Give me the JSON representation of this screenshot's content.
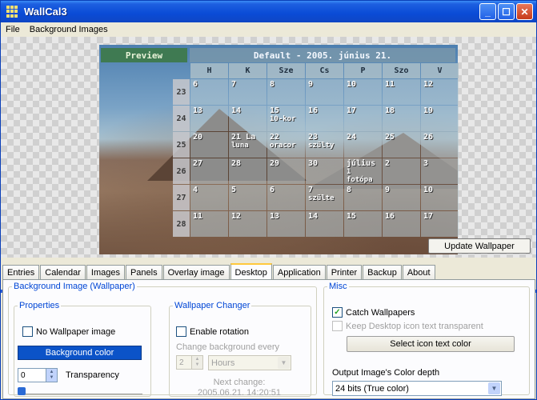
{
  "window": {
    "title": "WallCal3"
  },
  "menu": [
    "File",
    "Background Images"
  ],
  "preview": {
    "label": "Preview",
    "calendar_title": "Default - 2005. június 21.",
    "day_headers": [
      "H",
      "K",
      "Sze",
      "Cs",
      "P",
      "Szo",
      "V"
    ],
    "weeks": [
      {
        "week": "23",
        "days": [
          {
            "n": "6",
            "ev": ""
          },
          {
            "n": "7",
            "ev": ""
          },
          {
            "n": "8",
            "ev": ""
          },
          {
            "n": "9",
            "ev": ""
          },
          {
            "n": "10",
            "ev": ""
          },
          {
            "n": "11",
            "ev": ""
          },
          {
            "n": "12",
            "ev": ""
          }
        ]
      },
      {
        "week": "24",
        "days": [
          {
            "n": "13",
            "ev": ""
          },
          {
            "n": "14",
            "ev": ""
          },
          {
            "n": "15",
            "ev": "10-kor"
          },
          {
            "n": "16",
            "ev": ""
          },
          {
            "n": "17",
            "ev": ""
          },
          {
            "n": "18",
            "ev": ""
          },
          {
            "n": "19",
            "ev": ""
          }
        ]
      },
      {
        "week": "25",
        "days": [
          {
            "n": "20",
            "ev": ""
          },
          {
            "n": "21 La",
            "ev": "luna"
          },
          {
            "n": "22",
            "ev": "oracor"
          },
          {
            "n": "23",
            "ev": "szülty"
          },
          {
            "n": "24",
            "ev": ""
          },
          {
            "n": "25",
            "ev": ""
          },
          {
            "n": "26",
            "ev": ""
          }
        ]
      },
      {
        "week": "26",
        "days": [
          {
            "n": "27",
            "ev": ""
          },
          {
            "n": "28",
            "ev": ""
          },
          {
            "n": "29",
            "ev": ""
          },
          {
            "n": "30",
            "ev": ""
          },
          {
            "n": "július",
            "ev": "1 fotópa"
          },
          {
            "n": "2",
            "ev": ""
          },
          {
            "n": "3",
            "ev": ""
          }
        ]
      },
      {
        "week": "27",
        "days": [
          {
            "n": "4",
            "ev": ""
          },
          {
            "n": "5",
            "ev": ""
          },
          {
            "n": "6",
            "ev": ""
          },
          {
            "n": "7",
            "ev": "szülte"
          },
          {
            "n": "8",
            "ev": ""
          },
          {
            "n": "9",
            "ev": ""
          },
          {
            "n": "10",
            "ev": ""
          }
        ]
      },
      {
        "week": "28",
        "days": [
          {
            "n": "11",
            "ev": ""
          },
          {
            "n": "12",
            "ev": ""
          },
          {
            "n": "13",
            "ev": ""
          },
          {
            "n": "14",
            "ev": ""
          },
          {
            "n": "15",
            "ev": ""
          },
          {
            "n": "16",
            "ev": ""
          },
          {
            "n": "17",
            "ev": ""
          }
        ]
      }
    ],
    "update_button": "Update Wallpaper"
  },
  "tabs": [
    "Entries",
    "Calendar",
    "Images",
    "Panels",
    "Overlay image",
    "Desktop",
    "Application",
    "Printer",
    "Backup",
    "About"
  ],
  "active_tab": "Desktop",
  "desktop": {
    "background_group": "Background Image (Wallpaper)",
    "properties_group": "Properties",
    "no_wallpaper_label": "No Wallpaper image",
    "no_wallpaper_checked": false,
    "background_color_button": "Background color",
    "transparency_value": "0",
    "transparency_label": "Transparency",
    "transparency_level": 0,
    "changer_group": "Wallpaper Changer",
    "enable_rotation_label": "Enable rotation",
    "enable_rotation_checked": false,
    "change_every_label": "Change background every",
    "interval_value": "2",
    "interval_unit": "Hours",
    "next_change_label": "Next change:",
    "next_change_value": "2005.06.21. 14:20:51",
    "misc_group": "Misc",
    "catch_wallpapers_label": "Catch Wallpapers",
    "catch_wallpapers_checked": true,
    "keep_transparent_label": "Keep Desktop icon text transparent",
    "select_icon_color_button": "Select icon text color",
    "color_depth_label": "Output Image's Color depth",
    "color_depth_value": "24 bits (True color)"
  },
  "colors": {
    "title_bar": "#0a4bd6",
    "tab_active_accent": "#ffc83c",
    "group_legend": "#0046d5",
    "bg_color_button": "#0b53c8"
  }
}
